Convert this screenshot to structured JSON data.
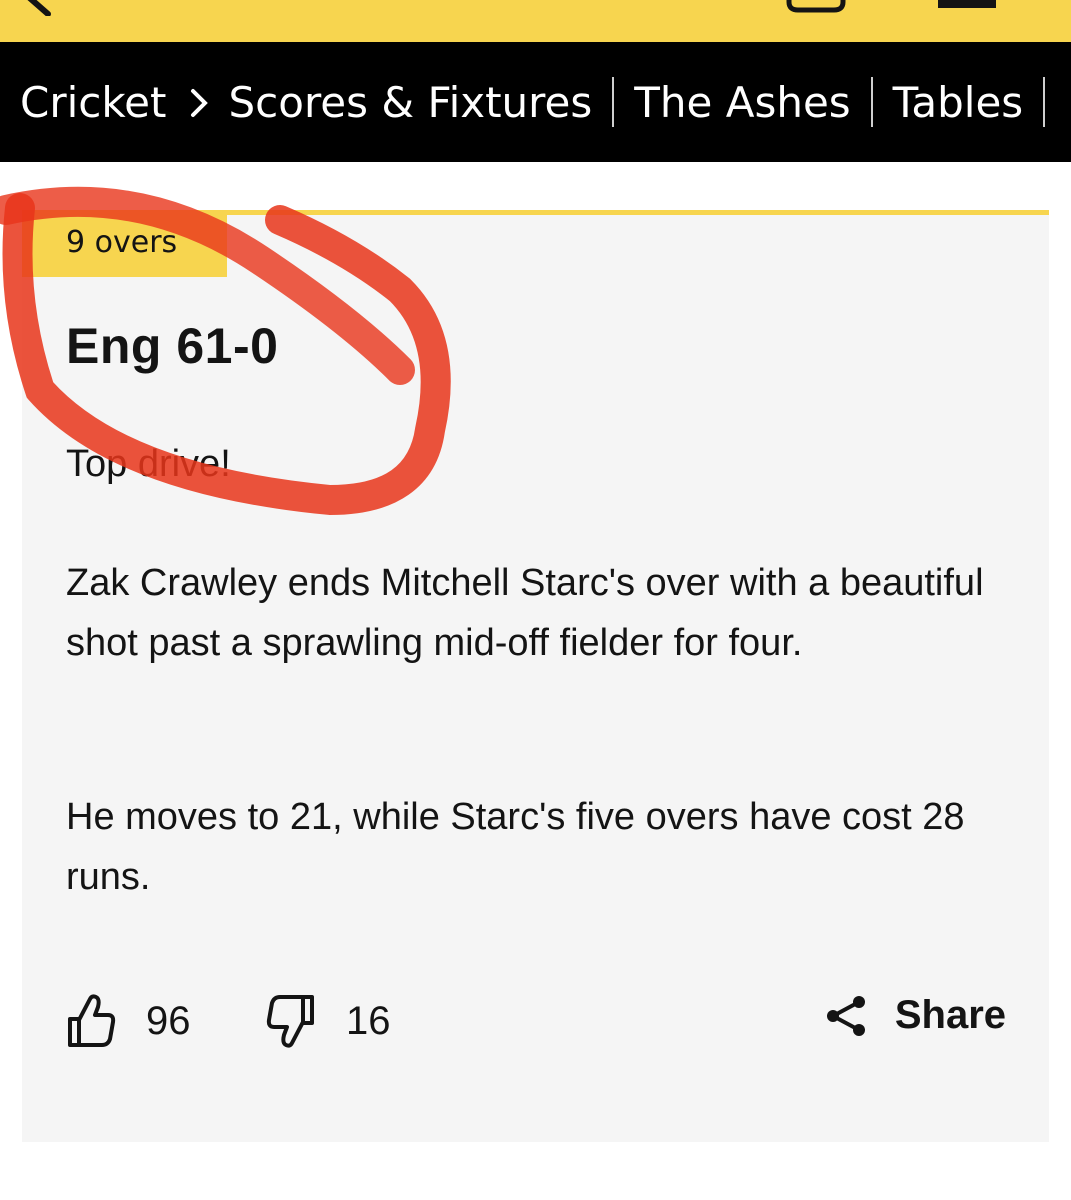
{
  "nav": {
    "root": "Cricket",
    "items": [
      "Scores & Fixtures",
      "The Ashes",
      "Tables"
    ]
  },
  "card": {
    "badge": "9 overs",
    "score": "Eng 61-0",
    "headline": "Top drive!",
    "paragraphs": [
      "Zak Crawley ends Mitchell Starc's over with a beautiful shot past a sprawling mid-off fielder for four.",
      "He moves to 21, while Starc's five overs have cost 28 runs."
    ],
    "likes": "96",
    "dislikes": "16",
    "share_label": "Share"
  },
  "colors": {
    "accent": "#f7d54f",
    "nav_bg": "#000000",
    "card_bg": "#f5f5f5",
    "annotation": "#e8351a"
  },
  "icons": [
    "back-icon",
    "cart-icon",
    "menu-icon",
    "chevron-right-icon",
    "thumbs-up-icon",
    "thumbs-down-icon",
    "share-icon"
  ]
}
